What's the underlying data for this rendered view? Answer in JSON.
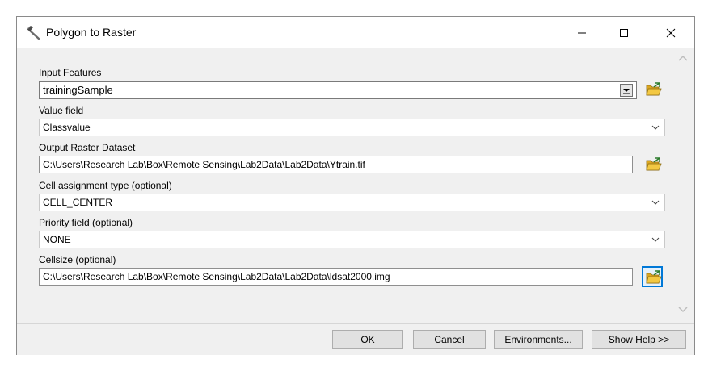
{
  "window": {
    "title": "Polygon to Raster",
    "controls": {
      "minimize": "—",
      "maximize": "☐",
      "close": "✕"
    }
  },
  "form": {
    "input_features": {
      "label": "Input Features",
      "value": "trainingSample"
    },
    "value_field": {
      "label": "Value field",
      "value": "Classvalue"
    },
    "output_raster": {
      "label": "Output Raster Dataset",
      "value": "C:\\Users\\Research Lab\\Box\\Remote Sensing\\Lab2Data\\Lab2Data\\Ytrain.tif"
    },
    "cell_assignment": {
      "label": "Cell assignment type (optional)",
      "value": "CELL_CENTER"
    },
    "priority_field": {
      "label": "Priority field (optional)",
      "value": "NONE"
    },
    "cellsize": {
      "label": "Cellsize (optional)",
      "value": "C:\\Users\\Research Lab\\Box\\Remote Sensing\\Lab2Data\\Lab2Data\\ldsat2000.img"
    }
  },
  "buttons": {
    "ok": "OK",
    "cancel": "Cancel",
    "environments": "Environments...",
    "show_help": "Show Help >>"
  },
  "icons": {
    "title": "hammer-icon",
    "browse": "folder-open-icon",
    "dropdown": "chevron-down-icon"
  },
  "colors": {
    "accent": "#0078d7",
    "folder": "#e8b931"
  }
}
